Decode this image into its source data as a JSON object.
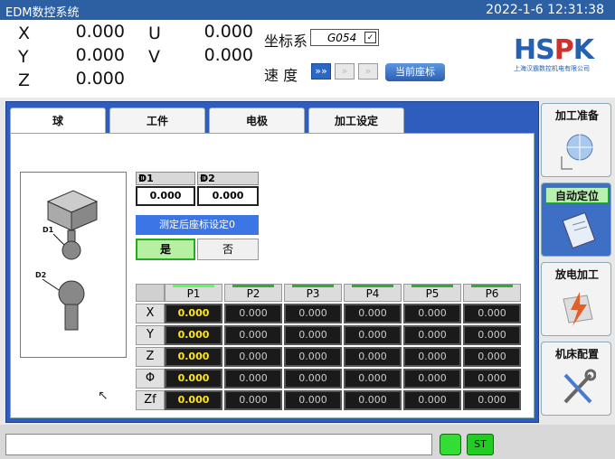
{
  "window": {
    "title": "EDM数控系统",
    "datetime": "2022-1-6 12:31:38"
  },
  "axes": [
    {
      "name": "X",
      "value": "0.000"
    },
    {
      "name": "Y",
      "value": "0.000"
    },
    {
      "name": "Z",
      "value": "0.000"
    },
    {
      "name": "U",
      "value": "0.000"
    },
    {
      "name": "V",
      "value": "0.000"
    }
  ],
  "coord_system": {
    "label": "坐标系",
    "value": "G054"
  },
  "speed": {
    "label": "速 度",
    "current_coord_button": "当前座标"
  },
  "logo": {
    "name": "HSPK",
    "company": "上海汉霸数控机电有限公司"
  },
  "tabs": [
    "球",
    "工件",
    "电极",
    "加工设定"
  ],
  "probe": {
    "d1_label": "D1",
    "d1_value": "0.000",
    "d2_label": "D2",
    "d2_value": "0.000",
    "phi_symbol": "Φ",
    "setting_bar": "测定后座标设定0",
    "yes_label": "是",
    "no_label": "否",
    "img_d1": "D1",
    "img_d2": "D2"
  },
  "table": {
    "columns": [
      "P1",
      "P2",
      "P3",
      "P4",
      "P5",
      "P6"
    ],
    "rows": [
      {
        "label": "X",
        "values": [
          "0.000",
          "0.000",
          "0.000",
          "0.000",
          "0.000",
          "0.000"
        ]
      },
      {
        "label": "Y",
        "values": [
          "0.000",
          "0.000",
          "0.000",
          "0.000",
          "0.000",
          "0.000"
        ]
      },
      {
        "label": "Z",
        "values": [
          "0.000",
          "0.000",
          "0.000",
          "0.000",
          "0.000",
          "0.000"
        ]
      },
      {
        "label": "Φ",
        "values": [
          "0.000",
          "0.000",
          "0.000",
          "0.000",
          "0.000",
          "0.000"
        ]
      },
      {
        "label": "Zf",
        "values": [
          "0.000",
          "0.000",
          "0.000",
          "0.000",
          "0.000",
          "0.000"
        ]
      }
    ]
  },
  "sidebar": [
    {
      "label": "加工准备",
      "icon": "target-icon"
    },
    {
      "label": "自动定位",
      "icon": "clipboard-icon",
      "active": true
    },
    {
      "label": "放电加工",
      "icon": "spark-icon"
    },
    {
      "label": "机床配置",
      "icon": "tools-icon"
    }
  ],
  "statusbar": {
    "st_label": "ST"
  },
  "colors": {
    "accent": "#2f5dbe",
    "active_green": "#b8f0b0",
    "value_yellow": "#ffe61a"
  }
}
